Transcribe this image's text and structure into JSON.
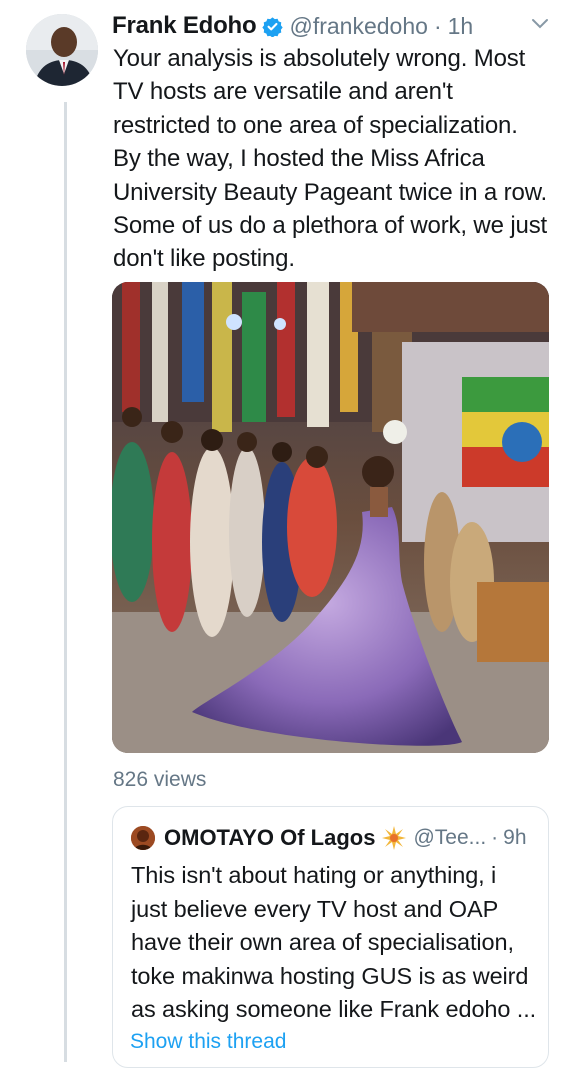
{
  "tweet": {
    "author_name": "Frank Edoho",
    "author_handle": "@frankedoho",
    "separator": "·",
    "time": "1h",
    "verified_icon": "verified-badge-icon",
    "text_lines": [
      "Your analysis is absolutely wrong. Most",
      "TV hosts are versatile and aren't",
      "restricted to one area of specialization.",
      "By the way, I hosted the Miss Africa",
      "University Beauty Pageant twice in a row.",
      "Some of us do a plethora of work, we just",
      "don't like posting."
    ],
    "views": "826 views"
  },
  "quoted": {
    "author_name": "OMOTAYO Of Lagos",
    "author_handle": "@Tee...",
    "separator": "·",
    "time": "9h",
    "emoji_icon": "sparkle-burst-icon",
    "text_lines": [
      "This isn't about hating or anything, i",
      "just believe every TV host and OAP",
      "have their own area of specialisation,",
      "toke makinwa hosting GUS is as weird",
      "as asking someone like Frank edoho ..."
    ],
    "link": "Show this thread"
  },
  "colors": {
    "link": "#1da1f2",
    "secondary_text": "#657786",
    "verified": "#1da1f2"
  }
}
